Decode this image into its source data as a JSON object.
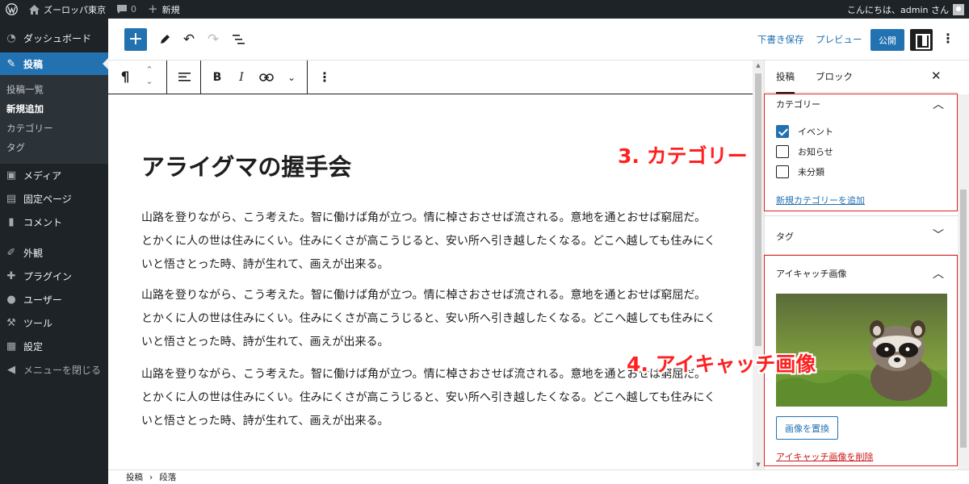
{
  "adminbar": {
    "site_name": "ズーロッパ東京",
    "comments_count": "0",
    "new_label": "新規",
    "greeting": "こんにちは、admin さん"
  },
  "sidebar": {
    "items": [
      {
        "label": "ダッシュボード",
        "icon": "dashboard-icon"
      },
      {
        "label": "投稿",
        "icon": "pin-icon",
        "active": true
      },
      {
        "label": "メディア",
        "icon": "media-icon"
      },
      {
        "label": "固定ページ",
        "icon": "page-icon"
      },
      {
        "label": "コメント",
        "icon": "comment-icon"
      },
      {
        "label": "外観",
        "icon": "brush-icon"
      },
      {
        "label": "プラグイン",
        "icon": "plugin-icon"
      },
      {
        "label": "ユーザー",
        "icon": "user-icon"
      },
      {
        "label": "ツール",
        "icon": "wrench-icon"
      },
      {
        "label": "設定",
        "icon": "settings-icon"
      },
      {
        "label": "メニューを閉じる",
        "icon": "collapse-icon"
      }
    ],
    "submenu": [
      "投稿一覧",
      "新規追加",
      "カテゴリー",
      "タグ"
    ],
    "current_submenu": "新規追加"
  },
  "header": {
    "save_draft": "下書き保存",
    "preview": "プレビュー",
    "publish": "公開"
  },
  "toolbar": {
    "paragraph_icon": "¶",
    "bold": "B",
    "italic": "I"
  },
  "post": {
    "title": "アライグマの握手会",
    "paragraphs": [
      "山路を登りながら、こう考えた。智に働けば角が立つ。情に棹さおさせば流される。意地を通とおせば窮屈だ。とかくに人の世は住みにくい。住みにくさが高こうじると、安い所へ引き越したくなる。どこへ越しても住みにくいと悟さとった時、詩が生れて、画えが出来る。",
      "山路を登りながら、こう考えた。智に働けば角が立つ。情に棹さおさせば流される。意地を通とおせば窮屈だ。とかくに人の世は住みにくい。住みにくさが高こうじると、安い所へ引き越したくなる。どこへ越しても住みにくいと悟さとった時、詩が生れて、画えが出来る。",
      "山路を登りながら、こう考えた。智に働けば角が立つ。情に棹さおさせば流される。意地を通とおせば窮屈だ。とかくに人の世は住みにくい。住みにくさが高こうじると、安い所へ引き越したくなる。どこへ越しても住みにくいと悟さとった時、詩が生れて、画えが出来る。"
    ]
  },
  "breadcrumb": {
    "post": "投稿",
    "separator": "›",
    "block": "段落"
  },
  "panel": {
    "tab_post": "投稿",
    "tab_block": "ブロック",
    "category_title": "カテゴリー",
    "categories": [
      {
        "label": "イベント",
        "checked": true
      },
      {
        "label": "お知らせ",
        "checked": false
      },
      {
        "label": "未分類",
        "checked": false
      }
    ],
    "add_category": "新規カテゴリーを追加",
    "tag_title": "タグ",
    "featured_title": "アイキャッチ画像",
    "replace_image": "画像を置換",
    "remove_image": "アイキャッチ画像を削除"
  },
  "annotations": {
    "category": "3. カテゴリー",
    "featured": "4. アイキャッチ画像"
  },
  "colors": {
    "accent": "#2271b1",
    "admin_dark": "#1d2327",
    "annotation_red": "#ff2020"
  }
}
